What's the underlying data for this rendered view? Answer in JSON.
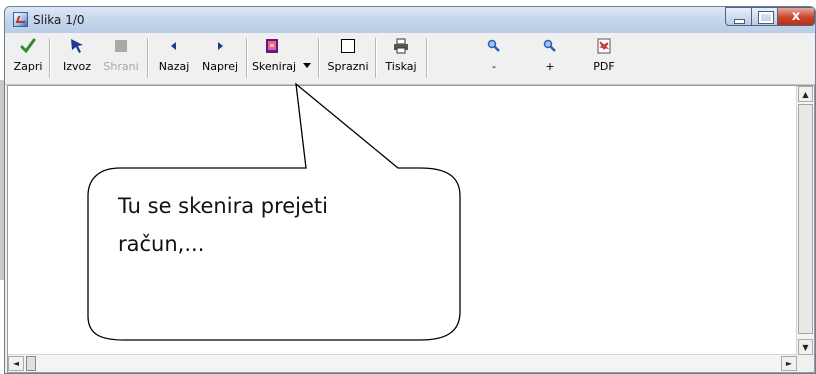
{
  "window": {
    "title": "Slika 1/0",
    "close_glyph": "x"
  },
  "toolbar": {
    "buttons": [
      {
        "label": "Zapri",
        "icon": "check-icon",
        "color": "#2e8b2e"
      },
      {
        "label": "Izvoz",
        "icon": "export-arrow-icon",
        "color": "#1b3c8c"
      },
      {
        "label": "Shrani",
        "icon": "save-icon",
        "disabled": true
      },
      {
        "label": "Nazaj",
        "icon": "back-icon",
        "color": "#1b3c8c"
      },
      {
        "label": "Naprej",
        "icon": "forward-icon",
        "color": "#1b3c8c"
      },
      {
        "label": "Skeniraj",
        "icon": "scanner-icon",
        "color": "#b21a8a"
      },
      {
        "label": "Sprazni",
        "icon": "empty-square-icon"
      },
      {
        "label": "Tiskaj",
        "icon": "printer-icon"
      },
      {
        "label": "-",
        "icon": "zoom-out-icon",
        "color": "#2a5fb0"
      },
      {
        "label": "+",
        "icon": "zoom-in-icon",
        "color": "#2a5fb0"
      },
      {
        "label": "PDF",
        "icon": "pdf-icon",
        "color": "#c0392b"
      }
    ]
  },
  "callout": {
    "line1": "Tu se skenira prejeti",
    "line2": "račun,..."
  },
  "scroll": {
    "up": "▲",
    "down": "▼",
    "left": "◄",
    "right": "►"
  }
}
